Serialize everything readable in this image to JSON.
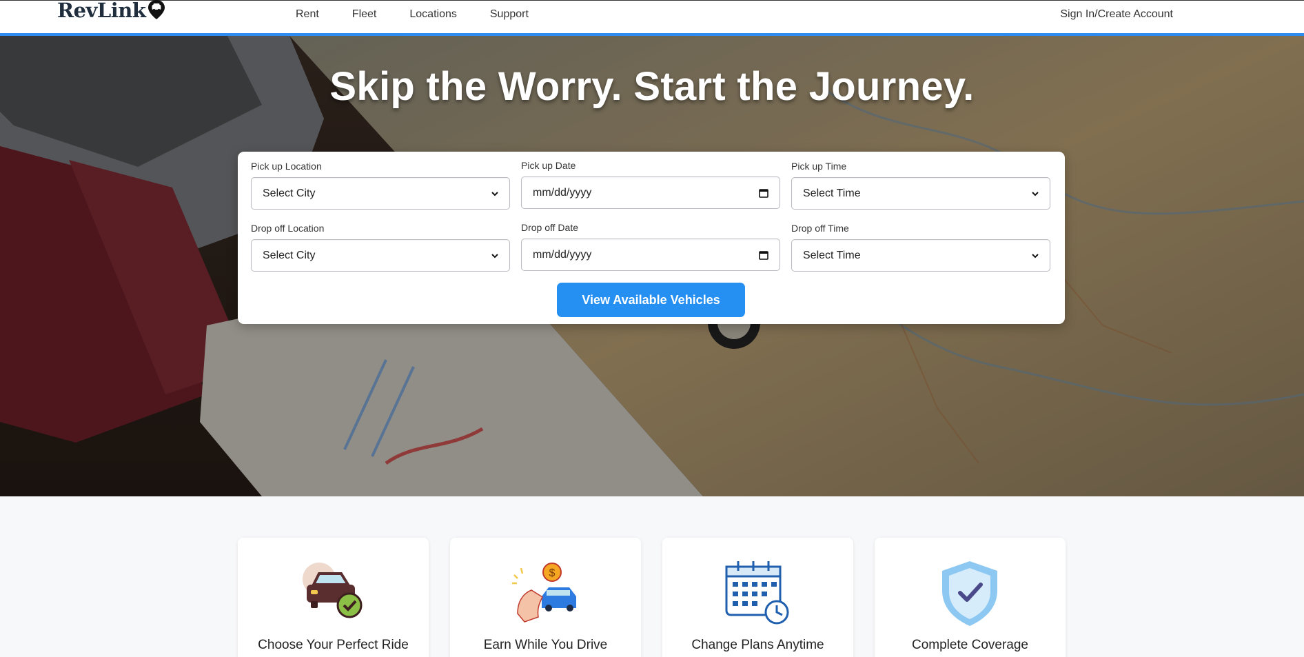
{
  "brand": {
    "name": "RevLink",
    "logo_icon": "map-pin-car-icon"
  },
  "nav": {
    "links": [
      "Rent",
      "Fleet",
      "Locations",
      "Support"
    ],
    "account": "Sign In/Create Account"
  },
  "hero": {
    "headline": "Skip the Worry. Start the Journey."
  },
  "booking": {
    "pickup_location": {
      "label": "Pick up Location",
      "value": "Select City"
    },
    "pickup_date": {
      "label": "Pick up Date",
      "placeholder": "mm/dd/yyyy"
    },
    "pickup_time": {
      "label": "Pick up Time",
      "value": "Select Time"
    },
    "dropoff_location": {
      "label": "Drop off Location",
      "value": "Select City"
    },
    "dropoff_date": {
      "label": "Drop off Date",
      "placeholder": "mm/dd/yyyy"
    },
    "dropoff_time": {
      "label": "Drop off Time",
      "value": "Select Time"
    },
    "submit": "View Available Vehicles"
  },
  "features": [
    {
      "title": "Choose Your Perfect Ride",
      "icon": "car-check-icon"
    },
    {
      "title": "Earn While You Drive",
      "icon": "hand-coin-car-icon"
    },
    {
      "title": "Change Plans Anytime",
      "icon": "calendar-clock-icon"
    },
    {
      "title": "Complete Coverage",
      "icon": "shield-check-icon"
    }
  ],
  "colors": {
    "accent": "#2590f2",
    "nav_border": "#2e8cf0",
    "text_dark": "#1f2d3d"
  }
}
